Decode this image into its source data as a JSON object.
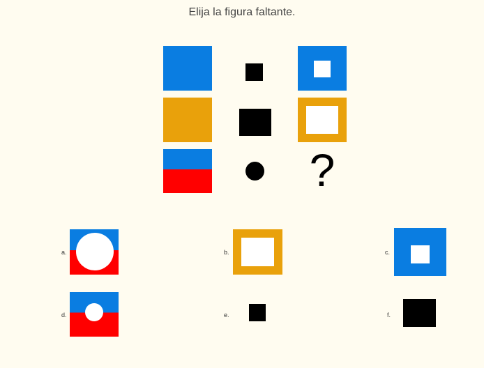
{
  "title": "Elija la figura faltante.",
  "colors": {
    "background": "#fffcf0",
    "blue": "#0a7de1",
    "orange": "#e9a10b",
    "red": "#ff0000",
    "black": "#000000",
    "white": "#ffffff"
  },
  "grid": [
    [
      "blue-square",
      "small-black-square",
      "blue-square-with-white-center"
    ],
    [
      "orange-square",
      "medium-black-square",
      "orange-square-outline"
    ],
    [
      "blue-red-split-square",
      "black-circle",
      "missing"
    ]
  ],
  "question_mark": "?",
  "options": [
    {
      "label": "a.",
      "shape": "blue-red-split-with-large-white-circle"
    },
    {
      "label": "b.",
      "shape": "orange-square-outline"
    },
    {
      "label": "c.",
      "shape": "blue-square-with-white-center"
    },
    {
      "label": "d.",
      "shape": "blue-red-split-with-small-white-circle"
    },
    {
      "label": "e.",
      "shape": "small-black-square"
    },
    {
      "label": "f.",
      "shape": "large-black-square"
    }
  ]
}
